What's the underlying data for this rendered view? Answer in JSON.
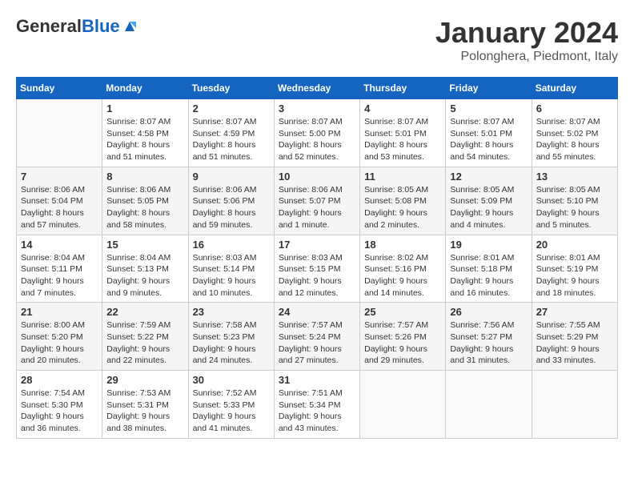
{
  "header": {
    "logo_general": "General",
    "logo_blue": "Blue",
    "month_title": "January 2024",
    "location": "Polonghera, Piedmont, Italy"
  },
  "weekdays": [
    "Sunday",
    "Monday",
    "Tuesday",
    "Wednesday",
    "Thursday",
    "Friday",
    "Saturday"
  ],
  "weeks": [
    [
      {
        "day": "",
        "detail": ""
      },
      {
        "day": "1",
        "detail": "Sunrise: 8:07 AM\nSunset: 4:58 PM\nDaylight: 8 hours\nand 51 minutes."
      },
      {
        "day": "2",
        "detail": "Sunrise: 8:07 AM\nSunset: 4:59 PM\nDaylight: 8 hours\nand 51 minutes."
      },
      {
        "day": "3",
        "detail": "Sunrise: 8:07 AM\nSunset: 5:00 PM\nDaylight: 8 hours\nand 52 minutes."
      },
      {
        "day": "4",
        "detail": "Sunrise: 8:07 AM\nSunset: 5:01 PM\nDaylight: 8 hours\nand 53 minutes."
      },
      {
        "day": "5",
        "detail": "Sunrise: 8:07 AM\nSunset: 5:01 PM\nDaylight: 8 hours\nand 54 minutes."
      },
      {
        "day": "6",
        "detail": "Sunrise: 8:07 AM\nSunset: 5:02 PM\nDaylight: 8 hours\nand 55 minutes."
      }
    ],
    [
      {
        "day": "7",
        "detail": "Sunrise: 8:06 AM\nSunset: 5:04 PM\nDaylight: 8 hours\nand 57 minutes."
      },
      {
        "day": "8",
        "detail": "Sunrise: 8:06 AM\nSunset: 5:05 PM\nDaylight: 8 hours\nand 58 minutes."
      },
      {
        "day": "9",
        "detail": "Sunrise: 8:06 AM\nSunset: 5:06 PM\nDaylight: 8 hours\nand 59 minutes."
      },
      {
        "day": "10",
        "detail": "Sunrise: 8:06 AM\nSunset: 5:07 PM\nDaylight: 9 hours\nand 1 minute."
      },
      {
        "day": "11",
        "detail": "Sunrise: 8:05 AM\nSunset: 5:08 PM\nDaylight: 9 hours\nand 2 minutes."
      },
      {
        "day": "12",
        "detail": "Sunrise: 8:05 AM\nSunset: 5:09 PM\nDaylight: 9 hours\nand 4 minutes."
      },
      {
        "day": "13",
        "detail": "Sunrise: 8:05 AM\nSunset: 5:10 PM\nDaylight: 9 hours\nand 5 minutes."
      }
    ],
    [
      {
        "day": "14",
        "detail": "Sunrise: 8:04 AM\nSunset: 5:11 PM\nDaylight: 9 hours\nand 7 minutes."
      },
      {
        "day": "15",
        "detail": "Sunrise: 8:04 AM\nSunset: 5:13 PM\nDaylight: 9 hours\nand 9 minutes."
      },
      {
        "day": "16",
        "detail": "Sunrise: 8:03 AM\nSunset: 5:14 PM\nDaylight: 9 hours\nand 10 minutes."
      },
      {
        "day": "17",
        "detail": "Sunrise: 8:03 AM\nSunset: 5:15 PM\nDaylight: 9 hours\nand 12 minutes."
      },
      {
        "day": "18",
        "detail": "Sunrise: 8:02 AM\nSunset: 5:16 PM\nDaylight: 9 hours\nand 14 minutes."
      },
      {
        "day": "19",
        "detail": "Sunrise: 8:01 AM\nSunset: 5:18 PM\nDaylight: 9 hours\nand 16 minutes."
      },
      {
        "day": "20",
        "detail": "Sunrise: 8:01 AM\nSunset: 5:19 PM\nDaylight: 9 hours\nand 18 minutes."
      }
    ],
    [
      {
        "day": "21",
        "detail": "Sunrise: 8:00 AM\nSunset: 5:20 PM\nDaylight: 9 hours\nand 20 minutes."
      },
      {
        "day": "22",
        "detail": "Sunrise: 7:59 AM\nSunset: 5:22 PM\nDaylight: 9 hours\nand 22 minutes."
      },
      {
        "day": "23",
        "detail": "Sunrise: 7:58 AM\nSunset: 5:23 PM\nDaylight: 9 hours\nand 24 minutes."
      },
      {
        "day": "24",
        "detail": "Sunrise: 7:57 AM\nSunset: 5:24 PM\nDaylight: 9 hours\nand 27 minutes."
      },
      {
        "day": "25",
        "detail": "Sunrise: 7:57 AM\nSunset: 5:26 PM\nDaylight: 9 hours\nand 29 minutes."
      },
      {
        "day": "26",
        "detail": "Sunrise: 7:56 AM\nSunset: 5:27 PM\nDaylight: 9 hours\nand 31 minutes."
      },
      {
        "day": "27",
        "detail": "Sunrise: 7:55 AM\nSunset: 5:29 PM\nDaylight: 9 hours\nand 33 minutes."
      }
    ],
    [
      {
        "day": "28",
        "detail": "Sunrise: 7:54 AM\nSunset: 5:30 PM\nDaylight: 9 hours\nand 36 minutes."
      },
      {
        "day": "29",
        "detail": "Sunrise: 7:53 AM\nSunset: 5:31 PM\nDaylight: 9 hours\nand 38 minutes."
      },
      {
        "day": "30",
        "detail": "Sunrise: 7:52 AM\nSunset: 5:33 PM\nDaylight: 9 hours\nand 41 minutes."
      },
      {
        "day": "31",
        "detail": "Sunrise: 7:51 AM\nSunset: 5:34 PM\nDaylight: 9 hours\nand 43 minutes."
      },
      {
        "day": "",
        "detail": ""
      },
      {
        "day": "",
        "detail": ""
      },
      {
        "day": "",
        "detail": ""
      }
    ]
  ]
}
